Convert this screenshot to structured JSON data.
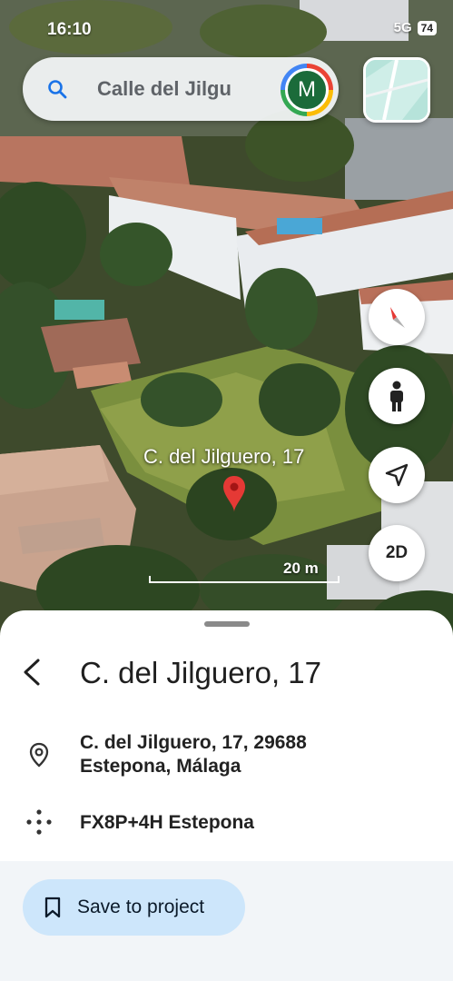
{
  "status_bar": {
    "time": "16:10",
    "network": "5G",
    "battery": "74"
  },
  "search": {
    "query": "Calle del Jilgu",
    "avatar_initial": "M"
  },
  "map": {
    "place_label": "C. del Jilguero, 17",
    "scale_label": "20 m",
    "mode_button": "2D",
    "pin_color": "#e53935"
  },
  "sheet": {
    "title": "C. del Jilguero, 17",
    "address_line1": "C. del Jilguero, 17, 29688",
    "address_line2": "Estepona, Málaga",
    "plus_code": "FX8P+4H Estepona",
    "save_label": "Save to project"
  },
  "icons": [
    "search-icon",
    "avatar",
    "layers-icon",
    "compass-icon",
    "street-view-icon",
    "navigate-icon",
    "map-pin-icon",
    "back-arrow-icon",
    "location-pin-icon",
    "plus-code-icon",
    "bookmark-icon"
  ],
  "colors": {
    "accent_button": "#cde6fb",
    "footer_bg": "#f2f5f8"
  }
}
